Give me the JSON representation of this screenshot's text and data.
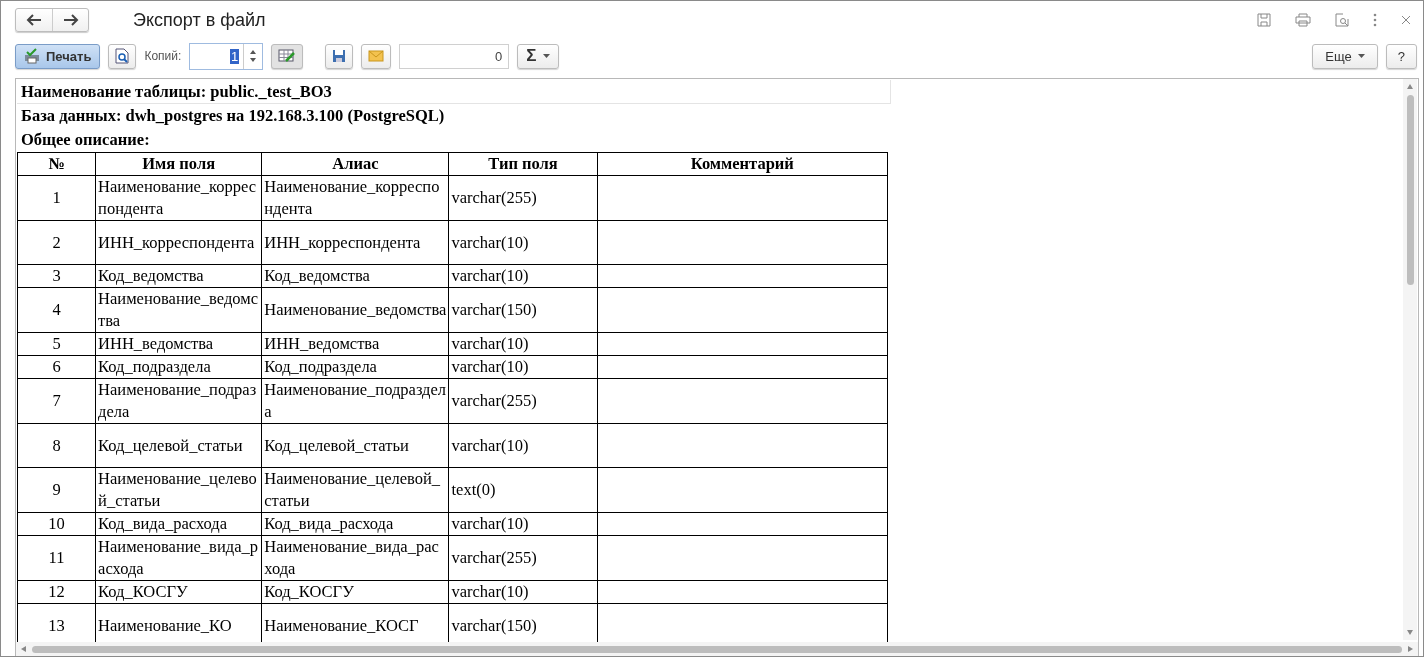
{
  "window": {
    "title": "Экспорт в файл"
  },
  "toolbar": {
    "print_button": "Печать",
    "copies_label": "Копий:",
    "copies_value": "1",
    "number_value": "0",
    "sum_button": "Σ",
    "more_button": "Еще",
    "help_button": "?"
  },
  "document": {
    "table_name": "Наименование таблицы: public._test_BO3",
    "database": "База данных: dwh_postgres на 192.168.3.100 (PostgreSQL)",
    "description": "Общее описание:",
    "columns": [
      "№",
      "Имя поля",
      "Алиас",
      "Тип поля",
      "Комментарий"
    ],
    "rows": [
      {
        "cells": [
          "1",
          "Наименование_корреспондента",
          "Наименование_корреспондента",
          "varchar(255)",
          ""
        ]
      },
      {
        "cells": [
          "2",
          "ИНН_корреспондента",
          "ИНН_корреспондента",
          "varchar(10)",
          ""
        ]
      },
      {
        "cells": [
          "3",
          "Код_ведомства",
          "Код_ведомства",
          "varchar(10)",
          ""
        ]
      },
      {
        "cells": [
          "4",
          "Наименование_ведомства",
          "Наименование_ведомства",
          "varchar(150)",
          ""
        ]
      },
      {
        "cells": [
          "5",
          "ИНН_ведомства",
          "ИНН_ведомства",
          "varchar(10)",
          ""
        ]
      },
      {
        "cells": [
          "6",
          "Код_подраздела",
          "Код_подраздела",
          "varchar(10)",
          ""
        ]
      },
      {
        "cells": [
          "7",
          "Наименование_подраздела",
          "Наименование_подраздела",
          "varchar(255)",
          ""
        ]
      },
      {
        "cells": [
          "8",
          "Код_целевой_статьи",
          "Код_целевой_статьи",
          "varchar(10)",
          ""
        ]
      },
      {
        "cells": [
          "9",
          "Наименование_целевой_статьи",
          "Наименование_целевой_статьи",
          "text(0)",
          ""
        ]
      },
      {
        "cells": [
          "10",
          "Код_вида_расхода",
          "Код_вида_расхода",
          "varchar(10)",
          ""
        ]
      },
      {
        "cells": [
          "11",
          "Наименование_вида_расхода",
          "Наименование_вида_расхода",
          "varchar(255)",
          ""
        ]
      },
      {
        "cells": [
          "12",
          "Код_КОСГУ",
          "Код_КОСГУ",
          "varchar(10)",
          ""
        ]
      },
      {
        "cells": [
          "13",
          "Наименование_КО",
          "Наименование_КОСГ",
          "varchar(150)",
          ""
        ]
      }
    ]
  }
}
